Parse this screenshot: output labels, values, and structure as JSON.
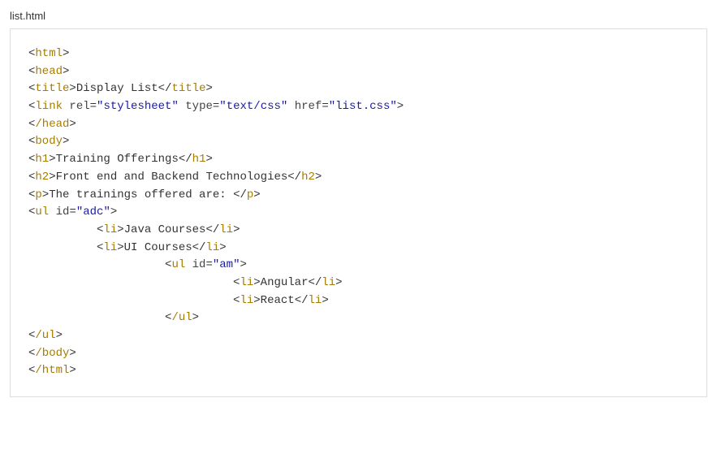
{
  "filename": "list.html",
  "code": {
    "open_html": "html",
    "open_head": "head",
    "title_tag": "title",
    "title_text": "Display List",
    "link_tag": "link",
    "link_rel_attr": "rel",
    "link_rel_val": "\"stylesheet\"",
    "link_type_attr": "type",
    "link_type_val": "\"text/css\"",
    "link_href_attr": "href",
    "link_href_val": "\"list.css\"",
    "close_head": "/head",
    "open_body": "body",
    "h1_tag": "h1",
    "h1_text": "Training Offerings",
    "h2_tag": "h2",
    "h2_text": "Front end and Backend Technologies",
    "p_tag": "p",
    "p_text": "The trainings offered are: ",
    "ul_tag": "ul",
    "ul1_id_attr": "id",
    "ul1_id_val": "\"adc\"",
    "li_tag": "li",
    "li1_text": "Java Courses",
    "li2_text": "UI Courses",
    "ul2_id_attr": "id",
    "ul2_id_val": "\"am\"",
    "li3_text": "Angular",
    "li4_text": "React",
    "close_ul": "/ul",
    "close_body": "/body",
    "close_html": "/html"
  }
}
